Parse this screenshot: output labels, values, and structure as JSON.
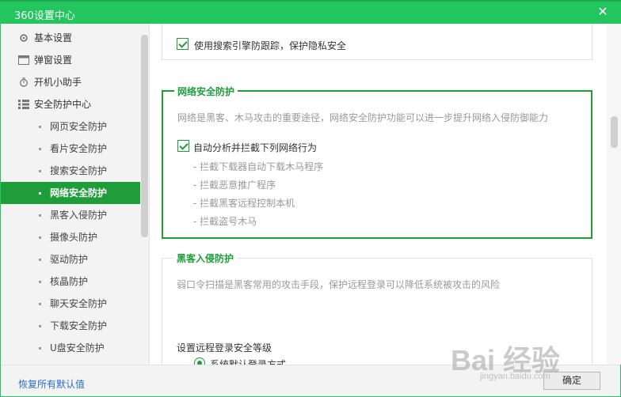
{
  "window": {
    "title": "360设置中心"
  },
  "sidebar": {
    "items": [
      {
        "label": "基本设置",
        "icon": "gear-icon"
      },
      {
        "label": "弹窗设置",
        "icon": "window-icon"
      },
      {
        "label": "开机小助手",
        "icon": "power-timer-icon"
      },
      {
        "label": "安全防护中心",
        "icon": "grid-icon"
      }
    ],
    "subitems": [
      {
        "label": "网页安全防护"
      },
      {
        "label": "看片安全防护"
      },
      {
        "label": "搜索安全防护"
      },
      {
        "label": "网络安全防护"
      },
      {
        "label": "黑客入侵防护"
      },
      {
        "label": "摄像头防护"
      },
      {
        "label": "驱动防护"
      },
      {
        "label": "核晶防护"
      },
      {
        "label": "聊天安全防护"
      },
      {
        "label": "下载安全防护"
      },
      {
        "label": "U盘安全防护"
      }
    ],
    "active_subitem": "网络安全防护"
  },
  "main": {
    "top_option": {
      "label": "使用搜索引擎防跟踪，保护隐私安全",
      "checked": true
    },
    "network": {
      "title": "网络安全防护",
      "description": "网络是黑客、木马攻击的重要途径，网络安全防护功能可以进一步提升网络入侵防御能力",
      "option": {
        "label": "自动分析并拦截下列网络行为",
        "checked": true
      },
      "lines": [
        "- 拦截下载器自动下载木马程序",
        "- 拦截恶意推广程序",
        "- 拦截黑客远程控制本机",
        "- 拦截盗号木马"
      ]
    },
    "hacker": {
      "title": "黑客入侵防护",
      "description": "弱口令扫描是黑客常用的攻击手段，保护远程登录可以降低系统被攻击的风险",
      "level_label": "设置远程登录安全等级",
      "radio_label": "系统默认登录方式"
    }
  },
  "footer": {
    "restore_label": "恢复所有默认值",
    "ok_label": "确定"
  },
  "watermark": {
    "text": "Bai 经验",
    "sub": "jingyan.baidu.com"
  },
  "colors": {
    "accent": "#1f9d3a",
    "titlebar": "#22c55e",
    "link": "#2a6cc8"
  }
}
